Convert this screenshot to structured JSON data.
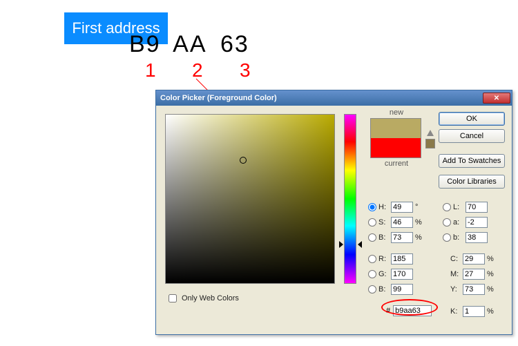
{
  "annotation": {
    "label": "First address",
    "hex_parts": [
      "B9",
      "AA",
      "63"
    ],
    "counters": [
      "1",
      "2",
      "3"
    ]
  },
  "dialog": {
    "title": "Color Picker (Foreground Color)",
    "new_label": "new",
    "current_label": "current",
    "buttons": {
      "ok": "OK",
      "cancel": "Cancel",
      "add_swatches": "Add To Swatches",
      "color_libraries": "Color Libraries"
    },
    "only_web": "Only Web Colors",
    "hsb": {
      "H": {
        "v": "49",
        "u": "°"
      },
      "S": {
        "v": "46",
        "u": "%"
      },
      "B": {
        "v": "73",
        "u": "%"
      }
    },
    "rgb": {
      "R": {
        "v": "185"
      },
      "G": {
        "v": "170"
      },
      "B": {
        "v": "99"
      }
    },
    "lab": {
      "L": {
        "v": "70"
      },
      "a": {
        "v": "-2"
      },
      "b": {
        "v": "38"
      }
    },
    "cmyk": {
      "C": {
        "v": "29",
        "u": "%"
      },
      "M": {
        "v": "27",
        "u": "%"
      },
      "Y": {
        "v": "73",
        "u": "%"
      },
      "K": {
        "v": "1",
        "u": "%"
      }
    },
    "hex_label": "#",
    "hex_value": "b9aa63",
    "colors": {
      "new": "#b9aa63",
      "current": "#ff0000"
    }
  }
}
